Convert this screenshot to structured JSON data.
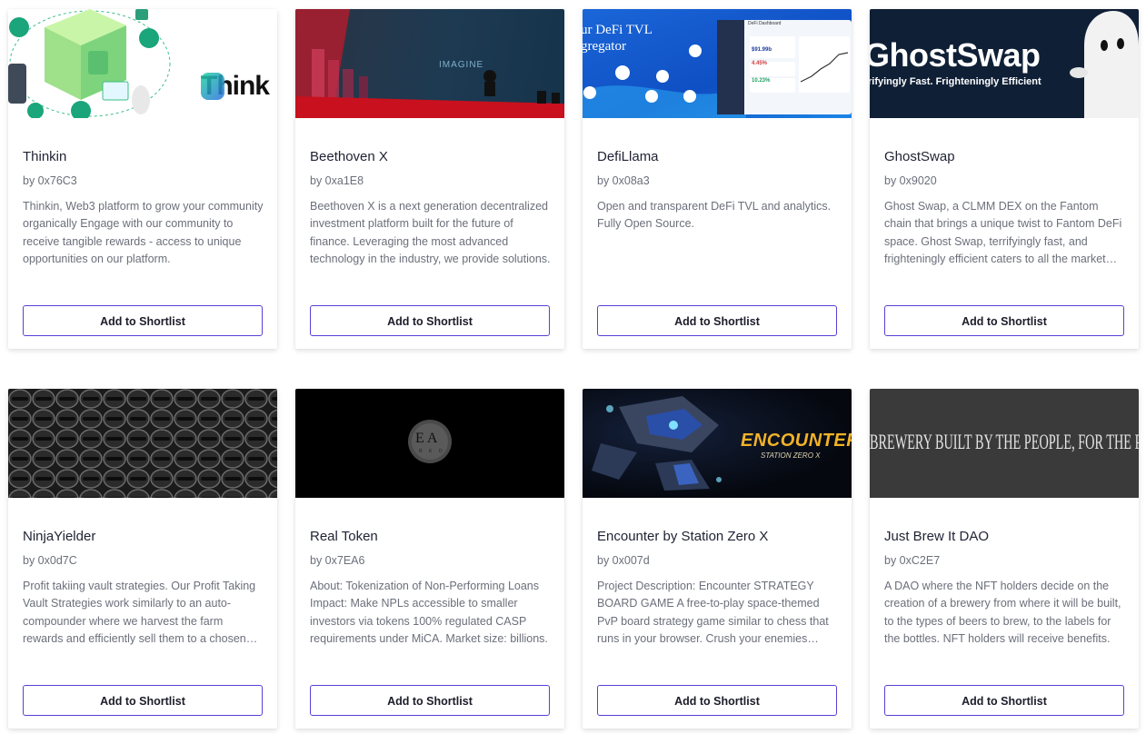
{
  "button_label": "Add to Shortlist",
  "colors": {
    "accent": "#5b3fd6",
    "title": "#1f2233",
    "muted": "#6b6f7a"
  },
  "cards": [
    {
      "title": "Thinkin",
      "author": "by 0x76C3",
      "description": "Thinkin, Web3 platform to grow your community organically Engage with our community to receive tangible rewards - access to unique opportunities on our platform.",
      "banner_text": "Think"
    },
    {
      "title": "Beethoven X",
      "author": "by 0xa1E8",
      "description": "Beethoven X is a next generation decentralized investment platform built for the future of finance. Leveraging the most advanced technology in the industry, we provide solutions.",
      "banner_text": "IMAGINE"
    },
    {
      "title": "DefiLlama",
      "author": "by 0x08a3",
      "description": "Open and transparent DeFi TVL and analytics. Fully Open Source.",
      "banner_text": "ur DeFi TVL gregator",
      "dashboard": {
        "title": "DeFi Dashboard",
        "value1": "$91.99b",
        "value2": "4.45%",
        "value3": "10.23%"
      }
    },
    {
      "title": "GhostSwap",
      "author": "by 0x9020",
      "description": "Ghost Swap, a CLMM DEX on the Fantom chain that brings a unique twist to Fantom DeFi space. Ghost Swap, terrifyingly fast, and frighteningly efficient caters to all the market participants.",
      "banner_text": "GhostSwap",
      "banner_sub": "rifyingly Fast.  Frighteningly Efficient"
    },
    {
      "title": "NinjaYielder",
      "author": "by 0x0d7C",
      "description": "Profit takiing vault strategies. Our Profit Taking Vault Strategies work similarly to an auto-compounder where we harvest the farm rewards and efficiently sell them to a chosen asset.",
      "banner_text": ""
    },
    {
      "title": "Real Token",
      "author": "by 0x7EA6",
      "description": "About: Tokenization of Non-Performing Loans Impact: Make NPLs accessible to smaller investors via tokens 100% regulated CASP requirements under MiCA. Market size: billions.",
      "banner_text": "E A",
      "banner_sub": "R K O"
    },
    {
      "title": "Encounter by Station Zero X",
      "author": "by 0x007d",
      "description": "Project Description: Encounter STRATEGY BOARD GAME A free-to-play space-themed PvP board strategy game similar to chess that runs in your browser. Crush your enemies today.",
      "banner_text": "ENCOUNTER",
      "banner_sub": "STATION ZERO X"
    },
    {
      "title": "Just Brew It DAO",
      "author": "by 0xC2E7",
      "description": "A DAO where the NFT holders decide on the creation of a brewery from where it will be built, to the types of beers to brew, to the labels for the bottles. NFT holders will receive benefits.",
      "banner_text": "BREWERY BUILT BY THE PEOPLE, FOR THE PEOPLE"
    }
  ]
}
